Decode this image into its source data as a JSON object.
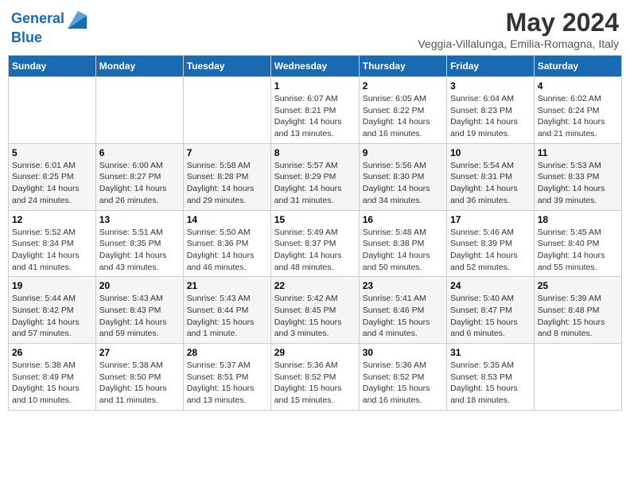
{
  "header": {
    "logo_line1": "General",
    "logo_line2": "Blue",
    "month_title": "May 2024",
    "subtitle": "Veggia-Villalunga, Emilia-Romagna, Italy"
  },
  "weekdays": [
    "Sunday",
    "Monday",
    "Tuesday",
    "Wednesday",
    "Thursday",
    "Friday",
    "Saturday"
  ],
  "weeks": [
    [
      {
        "day": "",
        "info": ""
      },
      {
        "day": "",
        "info": ""
      },
      {
        "day": "",
        "info": ""
      },
      {
        "day": "1",
        "info": "Sunrise: 6:07 AM\nSunset: 8:21 PM\nDaylight: 14 hours\nand 13 minutes."
      },
      {
        "day": "2",
        "info": "Sunrise: 6:05 AM\nSunset: 8:22 PM\nDaylight: 14 hours\nand 16 minutes."
      },
      {
        "day": "3",
        "info": "Sunrise: 6:04 AM\nSunset: 8:23 PM\nDaylight: 14 hours\nand 19 minutes."
      },
      {
        "day": "4",
        "info": "Sunrise: 6:02 AM\nSunset: 8:24 PM\nDaylight: 14 hours\nand 21 minutes."
      }
    ],
    [
      {
        "day": "5",
        "info": "Sunrise: 6:01 AM\nSunset: 8:25 PM\nDaylight: 14 hours\nand 24 minutes."
      },
      {
        "day": "6",
        "info": "Sunrise: 6:00 AM\nSunset: 8:27 PM\nDaylight: 14 hours\nand 26 minutes."
      },
      {
        "day": "7",
        "info": "Sunrise: 5:58 AM\nSunset: 8:28 PM\nDaylight: 14 hours\nand 29 minutes."
      },
      {
        "day": "8",
        "info": "Sunrise: 5:57 AM\nSunset: 8:29 PM\nDaylight: 14 hours\nand 31 minutes."
      },
      {
        "day": "9",
        "info": "Sunrise: 5:56 AM\nSunset: 8:30 PM\nDaylight: 14 hours\nand 34 minutes."
      },
      {
        "day": "10",
        "info": "Sunrise: 5:54 AM\nSunset: 8:31 PM\nDaylight: 14 hours\nand 36 minutes."
      },
      {
        "day": "11",
        "info": "Sunrise: 5:53 AM\nSunset: 8:33 PM\nDaylight: 14 hours\nand 39 minutes."
      }
    ],
    [
      {
        "day": "12",
        "info": "Sunrise: 5:52 AM\nSunset: 8:34 PM\nDaylight: 14 hours\nand 41 minutes."
      },
      {
        "day": "13",
        "info": "Sunrise: 5:51 AM\nSunset: 8:35 PM\nDaylight: 14 hours\nand 43 minutes."
      },
      {
        "day": "14",
        "info": "Sunrise: 5:50 AM\nSunset: 8:36 PM\nDaylight: 14 hours\nand 46 minutes."
      },
      {
        "day": "15",
        "info": "Sunrise: 5:49 AM\nSunset: 8:37 PM\nDaylight: 14 hours\nand 48 minutes."
      },
      {
        "day": "16",
        "info": "Sunrise: 5:48 AM\nSunset: 8:38 PM\nDaylight: 14 hours\nand 50 minutes."
      },
      {
        "day": "17",
        "info": "Sunrise: 5:46 AM\nSunset: 8:39 PM\nDaylight: 14 hours\nand 52 minutes."
      },
      {
        "day": "18",
        "info": "Sunrise: 5:45 AM\nSunset: 8:40 PM\nDaylight: 14 hours\nand 55 minutes."
      }
    ],
    [
      {
        "day": "19",
        "info": "Sunrise: 5:44 AM\nSunset: 8:42 PM\nDaylight: 14 hours\nand 57 minutes."
      },
      {
        "day": "20",
        "info": "Sunrise: 5:43 AM\nSunset: 8:43 PM\nDaylight: 14 hours\nand 59 minutes."
      },
      {
        "day": "21",
        "info": "Sunrise: 5:43 AM\nSunset: 8:44 PM\nDaylight: 15 hours\nand 1 minute."
      },
      {
        "day": "22",
        "info": "Sunrise: 5:42 AM\nSunset: 8:45 PM\nDaylight: 15 hours\nand 3 minutes."
      },
      {
        "day": "23",
        "info": "Sunrise: 5:41 AM\nSunset: 8:46 PM\nDaylight: 15 hours\nand 4 minutes."
      },
      {
        "day": "24",
        "info": "Sunrise: 5:40 AM\nSunset: 8:47 PM\nDaylight: 15 hours\nand 6 minutes."
      },
      {
        "day": "25",
        "info": "Sunrise: 5:39 AM\nSunset: 8:48 PM\nDaylight: 15 hours\nand 8 minutes."
      }
    ],
    [
      {
        "day": "26",
        "info": "Sunrise: 5:38 AM\nSunset: 8:49 PM\nDaylight: 15 hours\nand 10 minutes."
      },
      {
        "day": "27",
        "info": "Sunrise: 5:38 AM\nSunset: 8:50 PM\nDaylight: 15 hours\nand 11 minutes."
      },
      {
        "day": "28",
        "info": "Sunrise: 5:37 AM\nSunset: 8:51 PM\nDaylight: 15 hours\nand 13 minutes."
      },
      {
        "day": "29",
        "info": "Sunrise: 5:36 AM\nSunset: 8:52 PM\nDaylight: 15 hours\nand 15 minutes."
      },
      {
        "day": "30",
        "info": "Sunrise: 5:36 AM\nSunset: 8:52 PM\nDaylight: 15 hours\nand 16 minutes."
      },
      {
        "day": "31",
        "info": "Sunrise: 5:35 AM\nSunset: 8:53 PM\nDaylight: 15 hours\nand 18 minutes."
      },
      {
        "day": "",
        "info": ""
      }
    ]
  ]
}
